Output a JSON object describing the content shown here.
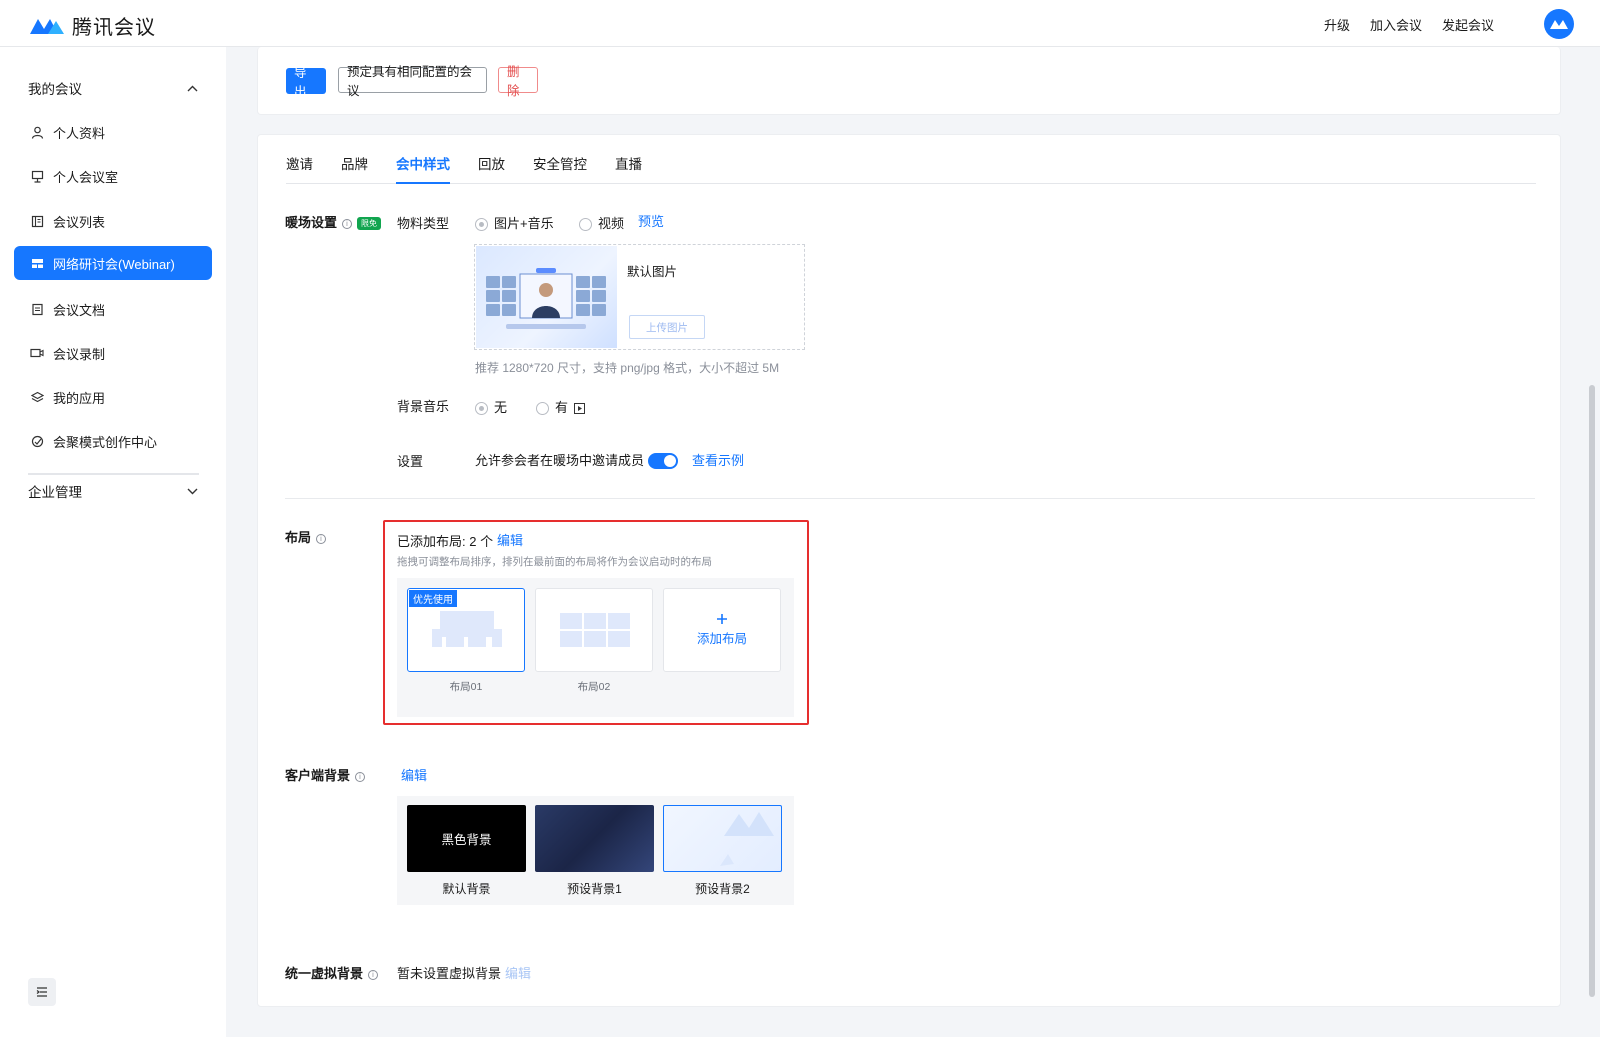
{
  "app": {
    "title": "腾讯会议"
  },
  "topnav": {
    "upgrade": "升级",
    "join": "加入会议",
    "start": "发起会议"
  },
  "sidebar": {
    "my_meetings": "我的会议",
    "items": [
      {
        "label": "个人资料",
        "icon": "user-icon"
      },
      {
        "label": "个人会议室",
        "icon": "meeting-room-icon"
      },
      {
        "label": "会议列表",
        "icon": "list-icon"
      },
      {
        "label": "网络研讨会(Webinar)",
        "icon": "webinar-icon",
        "active": true
      },
      {
        "label": "会议文档",
        "icon": "document-icon"
      },
      {
        "label": "会议录制",
        "icon": "record-icon"
      },
      {
        "label": "我的应用",
        "icon": "apps-icon"
      },
      {
        "label": "会聚模式创作中心",
        "icon": "creative-center-icon"
      }
    ],
    "enterprise": "企业管理"
  },
  "toolbar": {
    "export": "导出",
    "schedule_same": "预定具有相同配置的会议",
    "delete": "删除"
  },
  "tabs": [
    {
      "label": "邀请"
    },
    {
      "label": "品牌"
    },
    {
      "label": "会中样式",
      "active": true
    },
    {
      "label": "回放"
    },
    {
      "label": "安全管控"
    },
    {
      "label": "直播"
    }
  ],
  "warmup": {
    "label": "暖场设置",
    "tag": "限免",
    "material_label": "物料类型",
    "option_image_music": "图片+音乐",
    "option_video": "视频",
    "preview": "预览",
    "default_image": "默认图片",
    "upload": "上传图片",
    "hint": "推荐 1280*720 尺寸，支持 png/jpg 格式，大小不超过 5M",
    "music_label": "背景音乐",
    "music_none": "无",
    "music_yes": "有",
    "settings_label": "设置",
    "allow_invite": "允许参会者在暖场中邀请成员",
    "allow_invite_on": true,
    "view_example": "查看示例"
  },
  "layout": {
    "label": "布局",
    "added": "已添加布局: 2 个",
    "edit": "编辑",
    "hint": "拖拽可调整布局排序，排列在最前面的布局将作为会议启动时的布局",
    "priority_badge": "优先使用",
    "cards": [
      {
        "name": "布局01"
      },
      {
        "name": "布局02"
      }
    ],
    "add": "添加布局"
  },
  "client_bg": {
    "label": "客户端背景",
    "edit": "编辑",
    "black_text": "黑色背景",
    "items": [
      {
        "name": "默认背景"
      },
      {
        "name": "预设背景1"
      },
      {
        "name": "预设背景2"
      }
    ]
  },
  "virtual_bg": {
    "label": "统一虚拟背景",
    "status": "暂未设置虚拟背景",
    "edit": "编辑"
  },
  "colors": {
    "accent": "#1677ff",
    "danger": "#e34d4d",
    "highlight": "#e62e2e",
    "tag_green": "#11a54f"
  }
}
